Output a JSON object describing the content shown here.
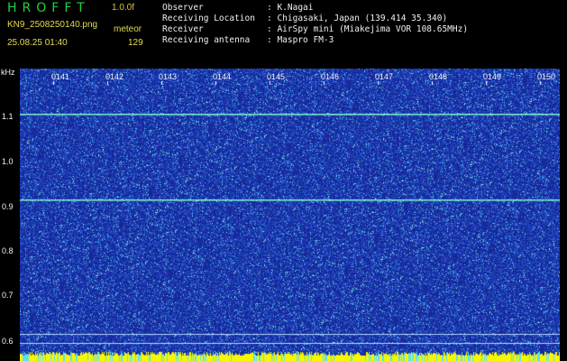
{
  "header": {
    "logo": "HROFFT",
    "version": "1.0.0f",
    "filename": "KN9_2508250140.png",
    "source_label": "meteor",
    "timestamp": "25.08.25 01:40",
    "count": "129",
    "fields": [
      {
        "label": "Observer",
        "value": ": K.Nagai"
      },
      {
        "label": "Receiving Location",
        "value": ": Chigasaki, Japan (139.414 35.340)"
      },
      {
        "label": "Receiver",
        "value": ": AirSpy mini (Miakejima VOR 108.65MHz)"
      },
      {
        "label": "Receiving antenna",
        "value": ": Maspro FM-3"
      }
    ]
  },
  "axis": {
    "unit": "kHz",
    "freq_ticks": [
      "1.1",
      "1.0",
      "0.9",
      "0.8",
      "0.7",
      "0.6"
    ],
    "time_ticks": [
      "0141",
      "0142",
      "0143",
      "0144",
      "0145",
      "0146",
      "0147",
      "0148",
      "0149",
      "0150"
    ]
  },
  "colors": {
    "background": "#000000",
    "noise_base": "#1e2ea8",
    "trace": "#7ffbd0",
    "level_bar": "#f7f700"
  }
}
